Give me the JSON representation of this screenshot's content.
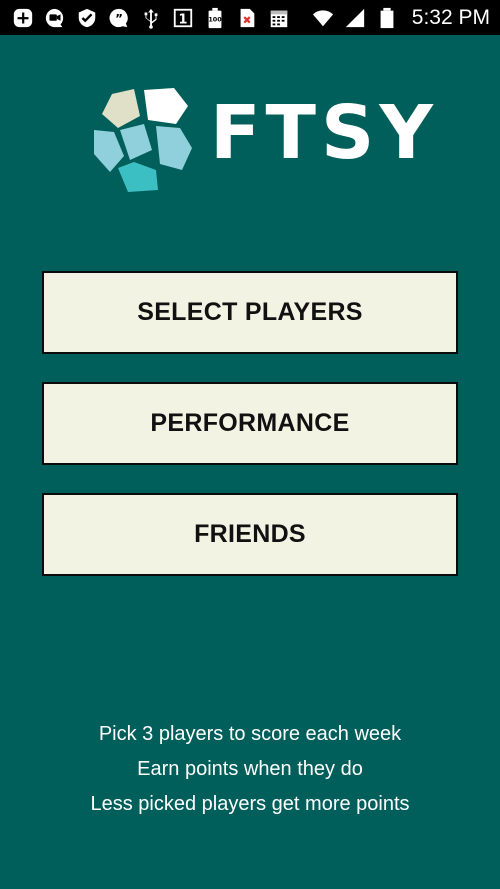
{
  "status_bar": {
    "time": "5:32 PM",
    "left_icons": [
      "add-box-icon",
      "video-chat-icon",
      "check-shield-icon",
      "quote-bubble-icon",
      "usb-icon",
      "number-one-icon",
      "battery-100-icon",
      "sim-error-icon",
      "calendar-icon"
    ],
    "right_icons": [
      "wifi-icon",
      "signal-icon",
      "battery-icon"
    ],
    "calendar_badge": "1",
    "battery_badge": "100"
  },
  "logo": {
    "text": "FTSY",
    "colors": {
      "cream": "#e0e0c8",
      "light_blue": "#8fd0dc",
      "white": "#ffffff",
      "teal": "#3bbfc3"
    }
  },
  "menu": {
    "items": [
      {
        "label": "SELECT PLAYERS"
      },
      {
        "label": "PERFORMANCE"
      },
      {
        "label": "FRIENDS"
      }
    ]
  },
  "info": {
    "lines": [
      "Pick 3 players to score each week",
      "Earn points when they do",
      "Less picked players get more points"
    ]
  },
  "colors": {
    "background": "#005f5a",
    "button_fill": "#f3f3e4",
    "button_border": "#0b0b0b"
  }
}
